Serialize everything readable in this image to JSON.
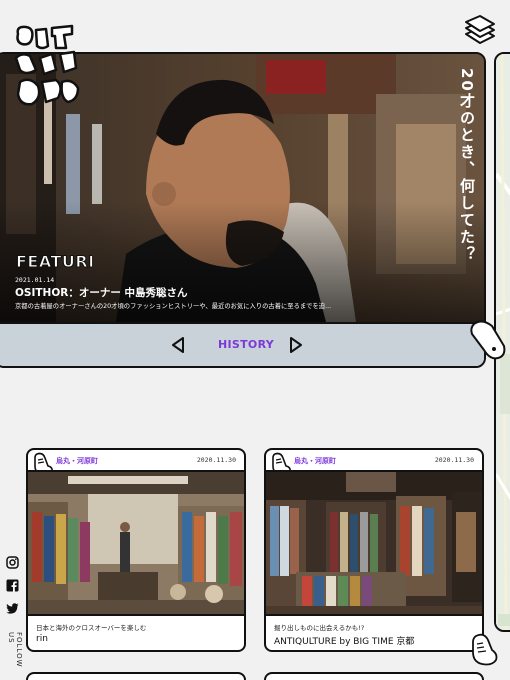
{
  "feature": {
    "badge": "FEATURE",
    "date": "2021.01.14",
    "title": "OSITHOR：オーナー 中島秀聡さん",
    "description": "京都の古着屋のオーナーさんの20才頃のファッションヒストリーや、最近のお気に入りの古着に至るまでを迫...",
    "vertical_caption": "20才のとき、何してた？",
    "nav_label": "HISTORY"
  },
  "social": {
    "follow_label": "FOLLOW US"
  },
  "cards": [
    {
      "area": "烏丸・河原町",
      "date": "2020.11.30",
      "subtitle": "日本と海外のクロスオーバーを楽しむ",
      "name": "rin"
    },
    {
      "area": "烏丸・河原町",
      "date": "2020.11.30",
      "subtitle": "掘り出しものに出会えるかも!?",
      "name": "ANTIQULTURE by BIG TIME 京都"
    }
  ],
  "colors": {
    "accent": "#7c3ad9",
    "nav_bg": "#cad2d9",
    "page_bg": "#f1f1f1"
  }
}
